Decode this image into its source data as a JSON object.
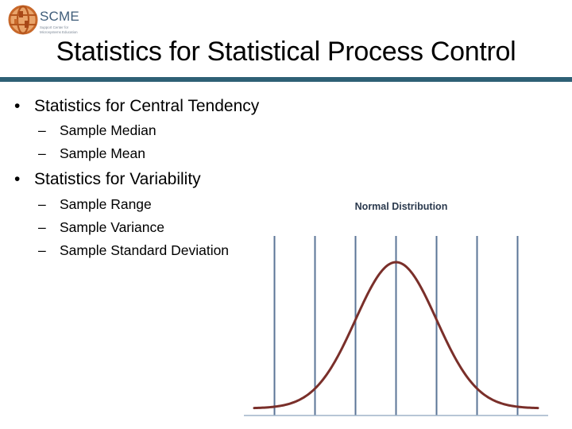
{
  "logo": {
    "name": "SCME",
    "tagline_line1": "Support Center for",
    "tagline_line2": "Microsystems Education",
    "icon": "globe-logo-icon",
    "colors": {
      "globe": "#c8682a",
      "text": "#3f5d7a"
    }
  },
  "slide": {
    "title": "Statistics for Statistical Process Control",
    "rule_color": "#2e6075"
  },
  "bullets": [
    {
      "marker": "•",
      "label": "Statistics for Central Tendency",
      "sub": [
        {
          "marker": "–",
          "label": "Sample Median"
        },
        {
          "marker": "–",
          "label": "Sample Mean"
        }
      ]
    },
    {
      "marker": "•",
      "label": "Statistics for Variability",
      "sub": [
        {
          "marker": "–",
          "label": "Sample Range"
        },
        {
          "marker": "–",
          "label": "Sample Variance"
        },
        {
          "marker": "–",
          "label": "Sample Standard Deviation"
        }
      ]
    }
  ],
  "chart_data": {
    "type": "line",
    "title": "Normal Distribution",
    "xlabel": "",
    "ylabel": "",
    "distribution": {
      "mean": 0,
      "std_dev": 1
    },
    "xlim": [
      -3.5,
      3.5
    ],
    "ylim": [
      0,
      0.4
    ],
    "vertical_lines_sigma": [
      -3,
      -2,
      -1,
      0,
      1,
      2,
      3
    ],
    "grid": false,
    "legend": "none",
    "colors": {
      "curve": "#7a2f2a",
      "lines": "#5b7597",
      "baseline": "#9fb3c8",
      "title": "#2b3a4e"
    }
  }
}
